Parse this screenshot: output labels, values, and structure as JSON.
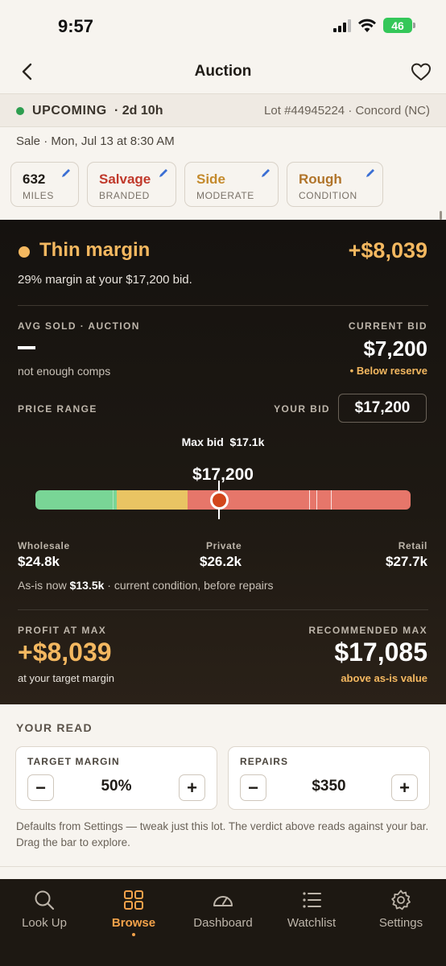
{
  "status_bar": {
    "time": "9:57",
    "battery": "46"
  },
  "nav": {
    "title": "Auction"
  },
  "lot": {
    "status": "UPCOMING",
    "time_left": "· 2d 10h",
    "info": "Lot #44945224 · Concord (NC)"
  },
  "sale": "Sale · Mon, Jul 13 at 8:30 AM",
  "chips": [
    {
      "value": "632",
      "sub": "MILES",
      "color": "#1f1b16"
    },
    {
      "value": "Salvage",
      "sub": "BRANDED",
      "color": "#c0392b"
    },
    {
      "value": "Side",
      "sub": "MODERATE",
      "color": "#c48a2c"
    },
    {
      "value": "Rough",
      "sub": "CONDITION",
      "color": "#b0742a"
    }
  ],
  "verdict": {
    "label": "Thin margin",
    "profit": "+$8,039",
    "margin_line": "29% margin at your $17,200 bid.",
    "color": "#f4b860"
  },
  "avg_sold": {
    "label": "AVG SOLD · AUCTION",
    "value": "—",
    "note": "not enough comps"
  },
  "current_bid": {
    "label": "CURRENT BID",
    "value": "$7,200",
    "note": "• Below reserve"
  },
  "price_range": {
    "label": "PRICE RANGE",
    "your_bid_label": "YOUR BID",
    "your_bid": "$17,200",
    "max_bid_label": "Max bid",
    "max_bid": "$17.1k",
    "handle_value": "$17,200",
    "min_value": 13500,
    "max_value": 30500,
    "handle_position_value": 17200,
    "zones": {
      "green_end": 17200,
      "yellow_end": 20400
    },
    "colors": {
      "green": "#79d596",
      "yellow": "#e9c463",
      "red": "#e6766a",
      "handle": "#d2461c"
    }
  },
  "points": [
    {
      "label": "Wholesale",
      "value": "$24.8k"
    },
    {
      "label": "Private",
      "value": "$26.2k"
    },
    {
      "label": "Retail",
      "value": "$27.7k"
    }
  ],
  "asis": {
    "prefix": "As-is now",
    "value": "$13.5k",
    "suffix": "· current condition, before repairs"
  },
  "profit_at_max": {
    "label": "PROFIT AT MAX",
    "value": "+$8,039",
    "note": "at your target margin"
  },
  "recommended_max": {
    "label": "RECOMMENDED MAX",
    "value": "$17,085",
    "note": "above as-is value"
  },
  "your_read": {
    "title": "YOUR READ",
    "target_margin": {
      "label": "TARGET MARGIN",
      "value": "50%"
    },
    "repairs": {
      "label": "REPAIRS",
      "value": "$350"
    },
    "minus": "−",
    "plus": "+",
    "note": "Defaults from Settings — tweak just this lot. The verdict above reads against your bar. Drag the bar to explore."
  },
  "tabs": [
    {
      "label": "Look Up",
      "icon": "search-icon"
    },
    {
      "label": "Browse",
      "icon": "grid-icon",
      "active": true
    },
    {
      "label": "Dashboard",
      "icon": "gauge-icon"
    },
    {
      "label": "Watchlist",
      "icon": "list-icon"
    },
    {
      "label": "Settings",
      "icon": "gear-icon"
    }
  ]
}
